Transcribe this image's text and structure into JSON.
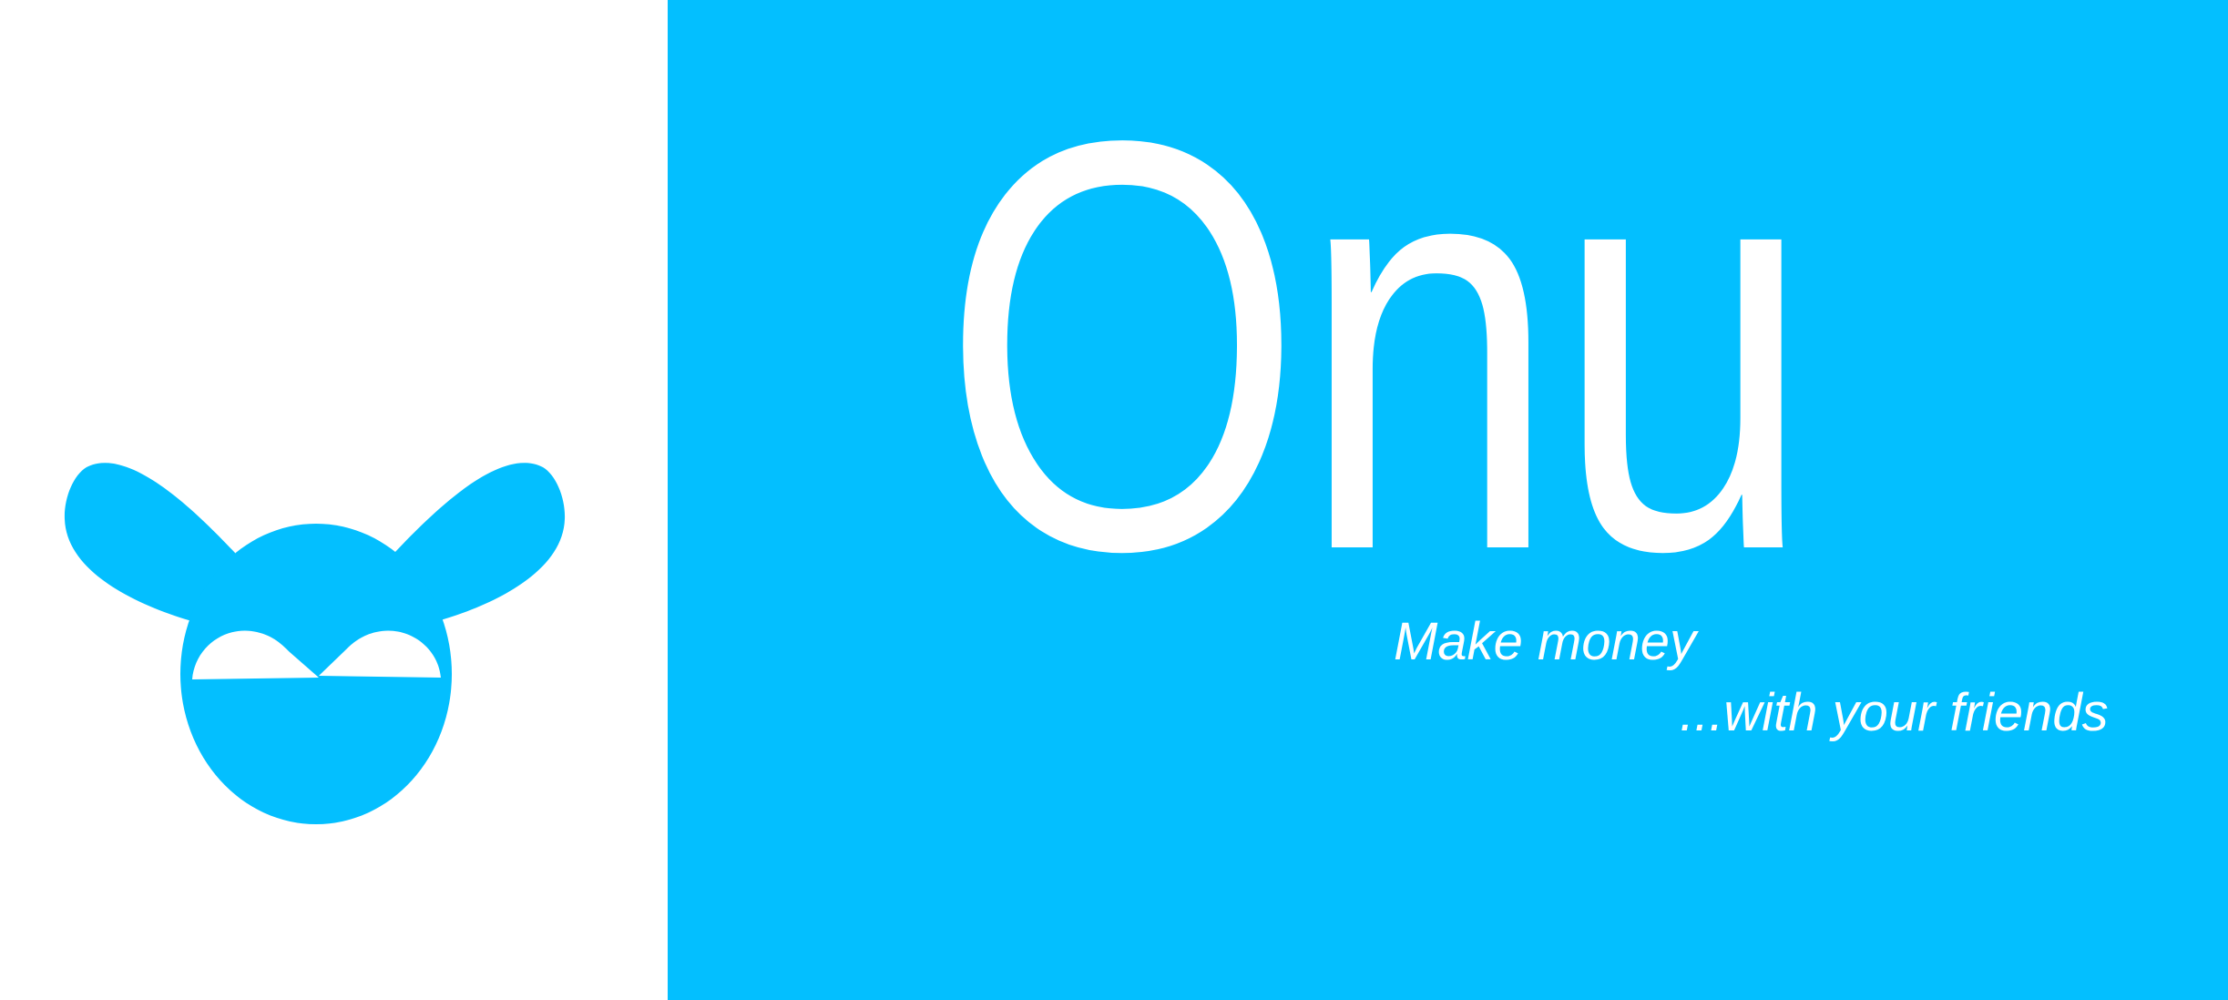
{
  "brand": {
    "name": "Onu",
    "tagline_line1": "Make money",
    "tagline_line2": "...with your friends"
  },
  "logo": {
    "icon": "bunny-mascot-icon"
  },
  "colors": {
    "accent": "#03bfff",
    "background": "#ffffff",
    "text_on_accent": "#ffffff"
  }
}
